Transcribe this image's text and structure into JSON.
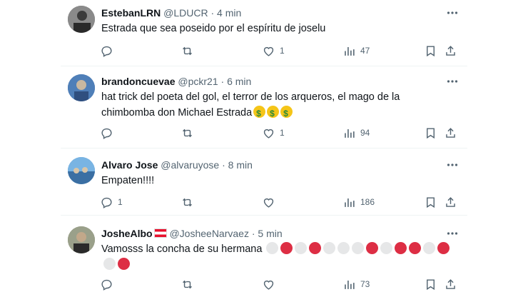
{
  "tweets": [
    {
      "display_name": "EstebanLRN",
      "handle": "@LDUCR",
      "separator": "·",
      "time": "4 min",
      "text": "Estrada que sea poseido por el espíritu de joselu",
      "replies": "",
      "reposts": "",
      "likes": "1",
      "views": "47",
      "avatar_color": "#6b6b6b"
    },
    {
      "display_name": "brandoncuevae",
      "handle": "@pckr21",
      "separator": "·",
      "time": "6 min",
      "text_line1": "hat trick del poeta del gol, el terror de los arqueros, el mago de la",
      "text_line2": "chimbomba don Michael Estrada",
      "emoji": [
        "money-mouth-face",
        "money-mouth-face",
        "money-mouth-face"
      ],
      "replies": "",
      "reposts": "",
      "likes": "1",
      "views": "94",
      "avatar_color": "#3a6aa8"
    },
    {
      "display_name": "Alvaro Jose",
      "handle": "@alvaruyose",
      "separator": "·",
      "time": "8 min",
      "text": "Empaten!!!!",
      "replies": "1",
      "reposts": "",
      "likes": "",
      "views": "186",
      "avatar_color": "#4e8fc9"
    },
    {
      "display_name": "JosheAlbo",
      "name_flag": "austria-flag",
      "handle": "@JosheeNarvaez",
      "separator": "·",
      "time": "5 min",
      "text": "Vamosss la concha de su hermana",
      "circles": [
        "white",
        "red",
        "white",
        "red",
        "white",
        "white",
        "white",
        "red",
        "white",
        "red",
        "red",
        "white",
        "red",
        "white",
        "red"
      ],
      "replies": "",
      "reposts": "",
      "likes": "",
      "views": "73",
      "avatar_color": "#7a8068"
    }
  ],
  "colors": {
    "red": "#dd2e44",
    "white": "#e6e7e8",
    "icon": "#536471",
    "divider": "#eff3f4"
  },
  "icons": [
    "reply-icon",
    "repost-icon",
    "like-icon",
    "views-icon",
    "bookmark-icon",
    "share-icon",
    "more-icon"
  ]
}
